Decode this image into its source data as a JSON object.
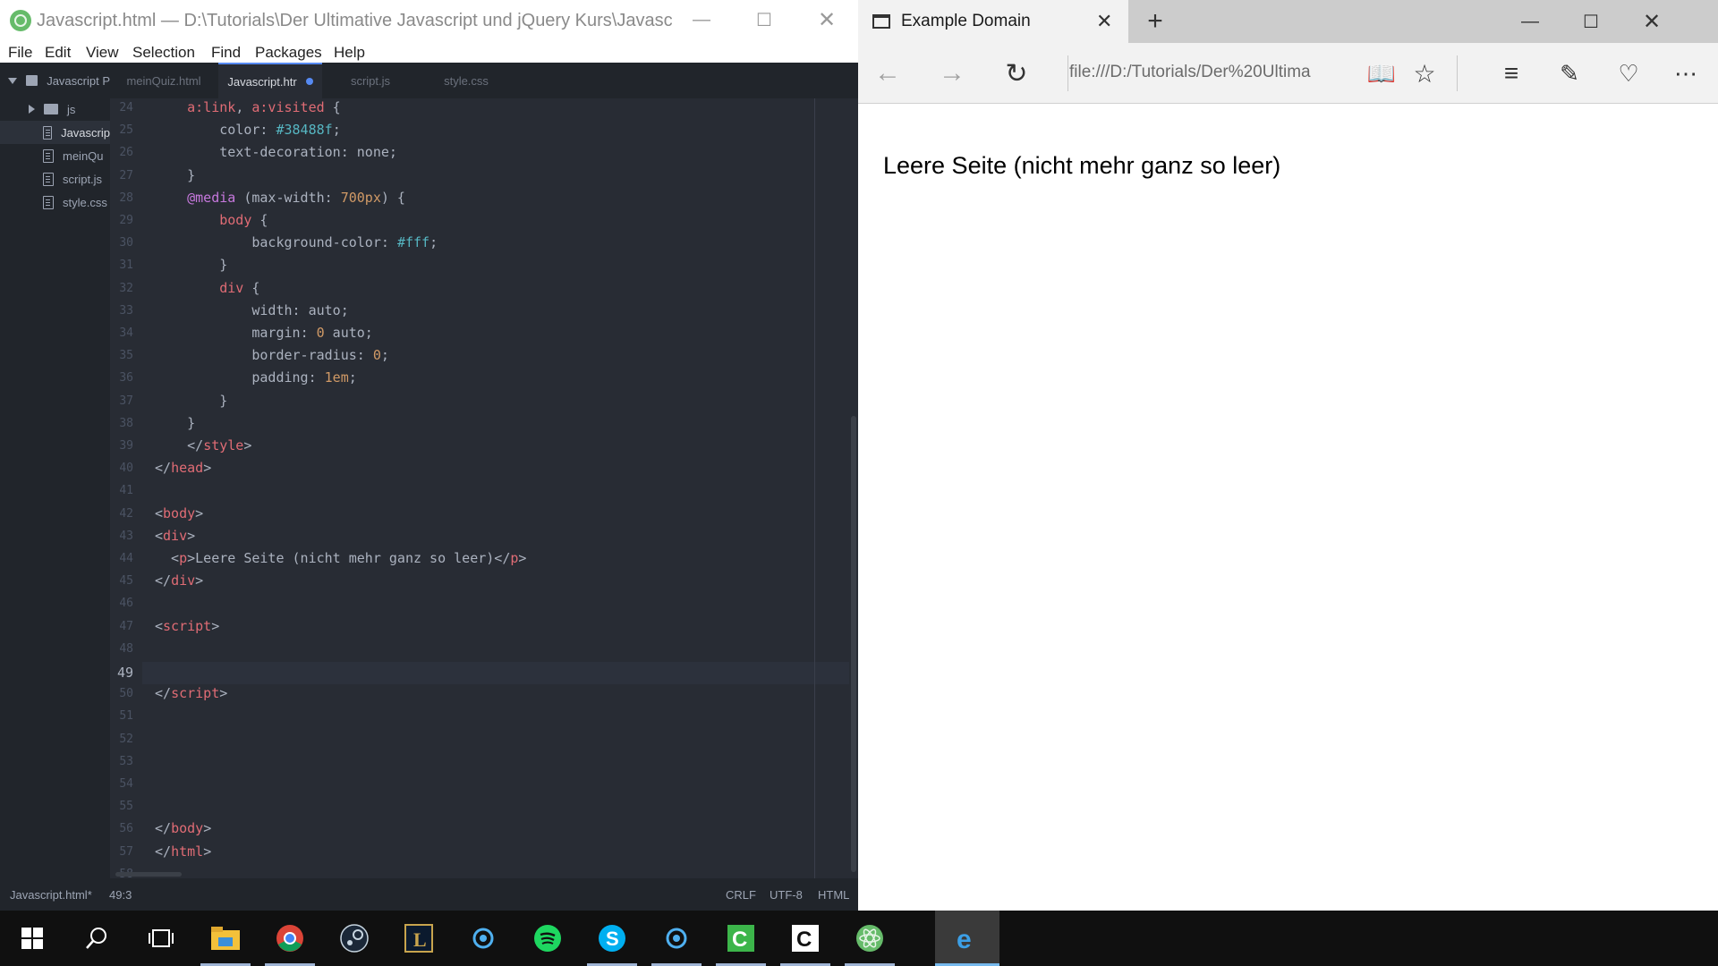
{
  "atom": {
    "title": "Javascript.html — D:\\Tutorials\\Der Ultimative Javascript und jQuery Kurs\\Javascript Proj...",
    "menu": [
      "File",
      "Edit",
      "View",
      "Selection",
      "Find",
      "Packages",
      "Help"
    ],
    "tree": {
      "project": "Javascript P",
      "items": [
        {
          "label": "js",
          "kind": "folder"
        },
        {
          "label": "Javascrip",
          "kind": "file",
          "selected": true
        },
        {
          "label": "meinQu",
          "kind": "file"
        },
        {
          "label": "script.js",
          "kind": "file"
        },
        {
          "label": "style.css",
          "kind": "file"
        }
      ]
    },
    "tabs": [
      {
        "label": "meinQuiz.html"
      },
      {
        "label": "Javascript.htr",
        "active": true,
        "modified": true
      },
      {
        "label": "script.js"
      },
      {
        "label": "style.css"
      }
    ],
    "code": [
      {
        "n": "24",
        "html": "    <span class=\"t\">a:link</span>, <span class=\"t\">a:visited</span> {"
      },
      {
        "n": "25",
        "html": "        <span class=\"p\">color</span>: <span class=\"s\">#38488f</span>;"
      },
      {
        "n": "26",
        "html": "        <span class=\"p\">text-decoration</span>: none;"
      },
      {
        "n": "27",
        "html": "    }"
      },
      {
        "n": "28",
        "html": "    <span class=\"k\">@media</span> (max-width: <span class=\"n\">700px</span>) {"
      },
      {
        "n": "29",
        "html": "        <span class=\"t\">body</span> {"
      },
      {
        "n": "30",
        "html": "            <span class=\"p\">background-color</span>: <span class=\"s\">#fff</span>;"
      },
      {
        "n": "31",
        "html": "        }"
      },
      {
        "n": "32",
        "html": "        <span class=\"t\">div</span> {"
      },
      {
        "n": "33",
        "html": "            <span class=\"p\">width</span>: auto;"
      },
      {
        "n": "34",
        "html": "            <span class=\"p\">margin</span>: <span class=\"n\">0</span> auto;"
      },
      {
        "n": "35",
        "html": "            <span class=\"p\">border-radius</span>: <span class=\"n\">0</span>;"
      },
      {
        "n": "36",
        "html": "            <span class=\"p\">padding</span>: <span class=\"n\">1em</span>;"
      },
      {
        "n": "37",
        "html": "        }"
      },
      {
        "n": "38",
        "html": "    }"
      },
      {
        "n": "39",
        "html": "    &lt;/<span class=\"t\">style</span>&gt;"
      },
      {
        "n": "40",
        "html": "&lt;/<span class=\"t\">head</span>&gt;"
      },
      {
        "n": "41",
        "html": ""
      },
      {
        "n": "42",
        "html": "&lt;<span class=\"t\">body</span>&gt;"
      },
      {
        "n": "43",
        "html": "&lt;<span class=\"t\">div</span>&gt;"
      },
      {
        "n": "44",
        "html": "  &lt;<span class=\"t\">p</span>&gt;Leere Seite (nicht mehr ganz so leer)&lt;/<span class=\"t\">p</span>&gt;"
      },
      {
        "n": "45",
        "html": "&lt;/<span class=\"t\">div</span>&gt;"
      },
      {
        "n": "46",
        "html": ""
      },
      {
        "n": "47",
        "html": "&lt;<span class=\"t\">script</span>&gt;"
      },
      {
        "n": "48",
        "html": ""
      },
      {
        "n": "49",
        "html": "",
        "current": true
      },
      {
        "n": "50",
        "html": "&lt;/<span class=\"t\">script</span>&gt;"
      },
      {
        "n": "51",
        "html": ""
      },
      {
        "n": "52",
        "html": ""
      },
      {
        "n": "53",
        "html": ""
      },
      {
        "n": "54",
        "html": ""
      },
      {
        "n": "55",
        "html": ""
      },
      {
        "n": "56",
        "html": "&lt;/<span class=\"t\">body</span>&gt;"
      },
      {
        "n": "57",
        "html": "&lt;/<span class=\"t\">html</span>&gt;"
      },
      {
        "n": "58",
        "html": ""
      }
    ],
    "status": {
      "file": "Javascript.html*",
      "cursor": "49:3",
      "line_ending": "CRLF",
      "encoding": "UTF-8",
      "grammar": "HTML"
    }
  },
  "edge": {
    "tab_title": "Example Domain",
    "url": "file:///D:/Tutorials/Der%20Ultima",
    "page_text": "Leere Seite (nicht mehr ganz so leer)"
  },
  "taskbar": {
    "items": [
      "start-icon",
      "search-icon",
      "task-view-icon",
      "file-explorer-icon",
      "chrome-icon",
      "steam-icon",
      "league-icon",
      "battlenet-icon",
      "spotify-icon",
      "skype-icon",
      "battlenet-icon",
      "camtasia-icon",
      "camtasia-recorder-icon",
      "atom-icon",
      "edge-icon"
    ]
  }
}
